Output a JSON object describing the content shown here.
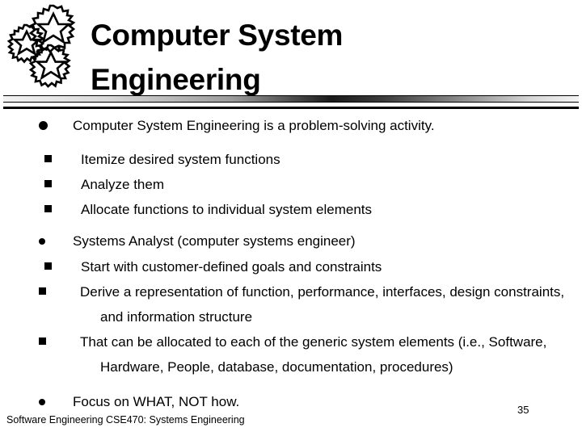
{
  "slide": {
    "title_lines": [
      "Computer System",
      "Engineering"
    ],
    "logo_icon": "gears-icon",
    "bullets": [
      {
        "level": 1,
        "marker": "filled-circle",
        "text": "Computer System Engineering is a problem-solving activity."
      },
      {
        "level": 2,
        "marker": "filled-square",
        "text": "Itemize desired system functions"
      },
      {
        "level": 2,
        "marker": "filled-square",
        "text": "Analyze them"
      },
      {
        "level": 2,
        "marker": "filled-square",
        "text": "Allocate functions to individual system elements"
      },
      {
        "level": 1,
        "marker": "filled-circle",
        "text": "Systems Analyst (computer systems engineer)"
      },
      {
        "level": 2,
        "marker": "filled-square",
        "text": "Start with customer-defined goals and constraints"
      },
      {
        "level": 2,
        "marker": "filled-square",
        "text": "Derive a representation of function, performance, interfaces, design constraints, and information structure"
      },
      {
        "level": 2,
        "marker": "filled-square",
        "text": "That can be allocated to each of the generic system elements (i.e., Software, Hardware, People, database, documentation, procedures)"
      },
      {
        "level": 1,
        "marker": "filled-circle",
        "text": "Focus on WHAT, NOT how."
      }
    ],
    "footer": "Software Engineering CSE470: Systems Engineering",
    "page_number": "35"
  },
  "colors": {
    "background": "#ffffff",
    "text": "#000000",
    "divider_light": "#f2f2f2",
    "divider_dark": "#1a1a1a"
  }
}
